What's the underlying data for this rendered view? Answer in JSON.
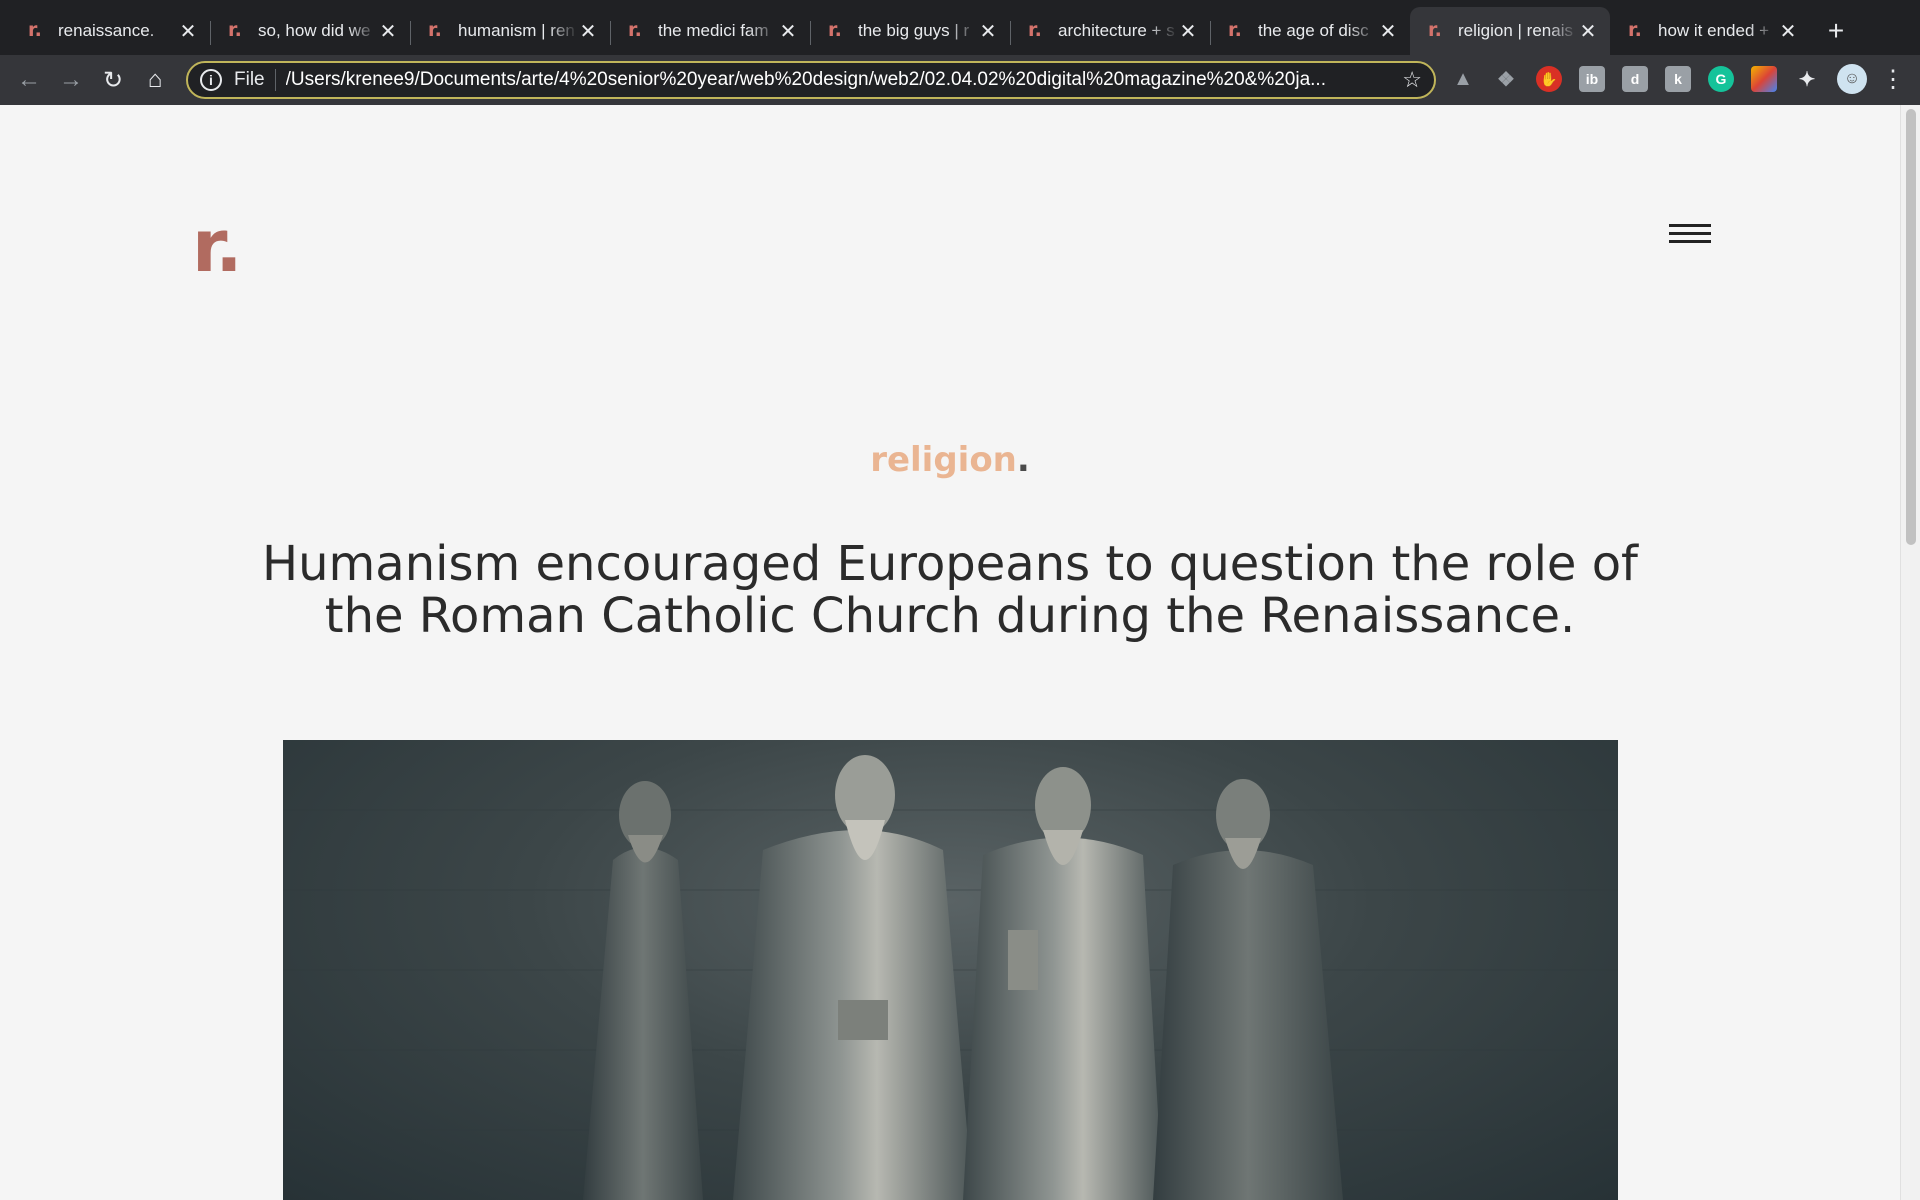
{
  "browser": {
    "tabs": [
      {
        "title": "renaissance.",
        "active": false
      },
      {
        "title": "so, how did we",
        "active": false
      },
      {
        "title": "humanism | ren",
        "active": false
      },
      {
        "title": "the medici fam",
        "active": false
      },
      {
        "title": "the big guys | r",
        "active": false
      },
      {
        "title": "architecture + s",
        "active": false
      },
      {
        "title": "the age of disc",
        "active": false
      },
      {
        "title": "religion | renais",
        "active": true
      },
      {
        "title": "how it ended +",
        "active": false
      }
    ],
    "favicon_text": "r.",
    "close_glyph": "✕",
    "new_tab_glyph": "+",
    "omnibox": {
      "scheme_label": "File",
      "url": "/Users/krenee9/Documents/arte/4%20senior%20year/web%20design/web2/02.04.02%20digital%20magazine%20&%20ja..."
    },
    "extensions": [
      "drive-icon",
      "dropbox-icon",
      "stop-icon",
      "ib-icon",
      "d-icon",
      "k-icon",
      "grammarly-icon",
      "color-icon",
      "puzzle-icon"
    ]
  },
  "page": {
    "logo": "r.",
    "section": {
      "word": "religion",
      "dot": "."
    },
    "headline_line1": "Humanism encouraged Europeans to question the role of",
    "headline_line2": "the Roman Catholic Church during the Renaissance.",
    "colors": {
      "logo": "#b16b60",
      "section_word": "#eab592",
      "text": "#2b2b2b",
      "background": "#f5f5f5"
    }
  }
}
